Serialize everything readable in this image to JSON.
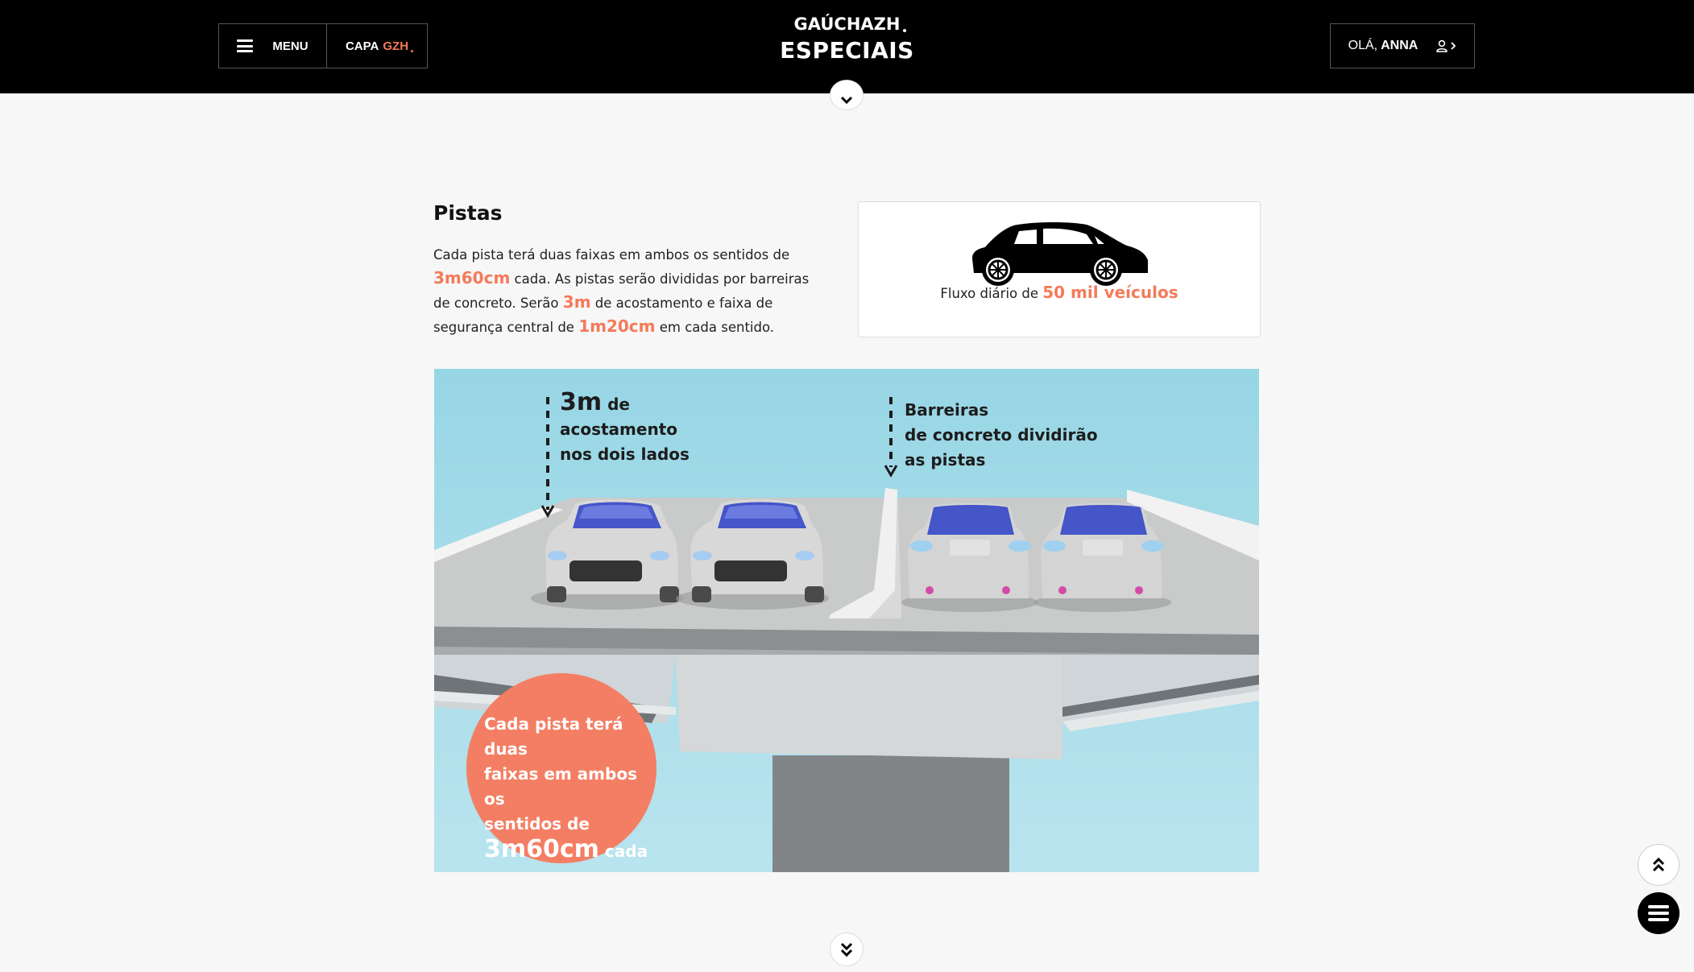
{
  "header": {
    "menu_label": "MENU",
    "capa_label": "CAPA",
    "capa_brand": "GZH",
    "brand_logo": "GAÚCHAZH",
    "brand_section": "ESPECIAIS",
    "user_greeting": "OLÁ,",
    "user_name": "ANNA"
  },
  "section": {
    "title": "Pistas",
    "text_1": "Cada pista terá duas faixas em ambos os sentidos de",
    "hl_1": "3m60cm",
    "text_2": "cada. As pistas serão divididas por barreiras de concreto. Serão",
    "hl_2": "3m",
    "text_3": "de acostamento e faixa de segurança central de",
    "hl_3": "1m20cm",
    "text_4": "em cada sentido."
  },
  "stat_card": {
    "prefix": "Fluxo diário de",
    "value": "50 mil veículos",
    "icon": "car-icon"
  },
  "illustration": {
    "left_big": "3m",
    "left_small": "de",
    "left_line2": "acostamento",
    "left_line3": "nos dois lados",
    "right_line1": "Barreiras",
    "right_line2": "de concreto dividirão",
    "right_line3": "as pistas",
    "circle_line1": "Cada pista terá duas",
    "circle_line2": "faixas em ambos os",
    "circle_line3": "sentidos de",
    "circle_big": "3m60cm",
    "circle_small": "cada"
  },
  "colors": {
    "accent": "#f47a5a",
    "header_bg": "#000000",
    "page_bg": "#f7f7f7",
    "sky": "#a9dde9"
  },
  "icons": [
    "hamburger-icon",
    "user-icon",
    "chevron-down-icon",
    "double-chevron-down-icon",
    "double-chevron-up-icon",
    "car-icon"
  ]
}
